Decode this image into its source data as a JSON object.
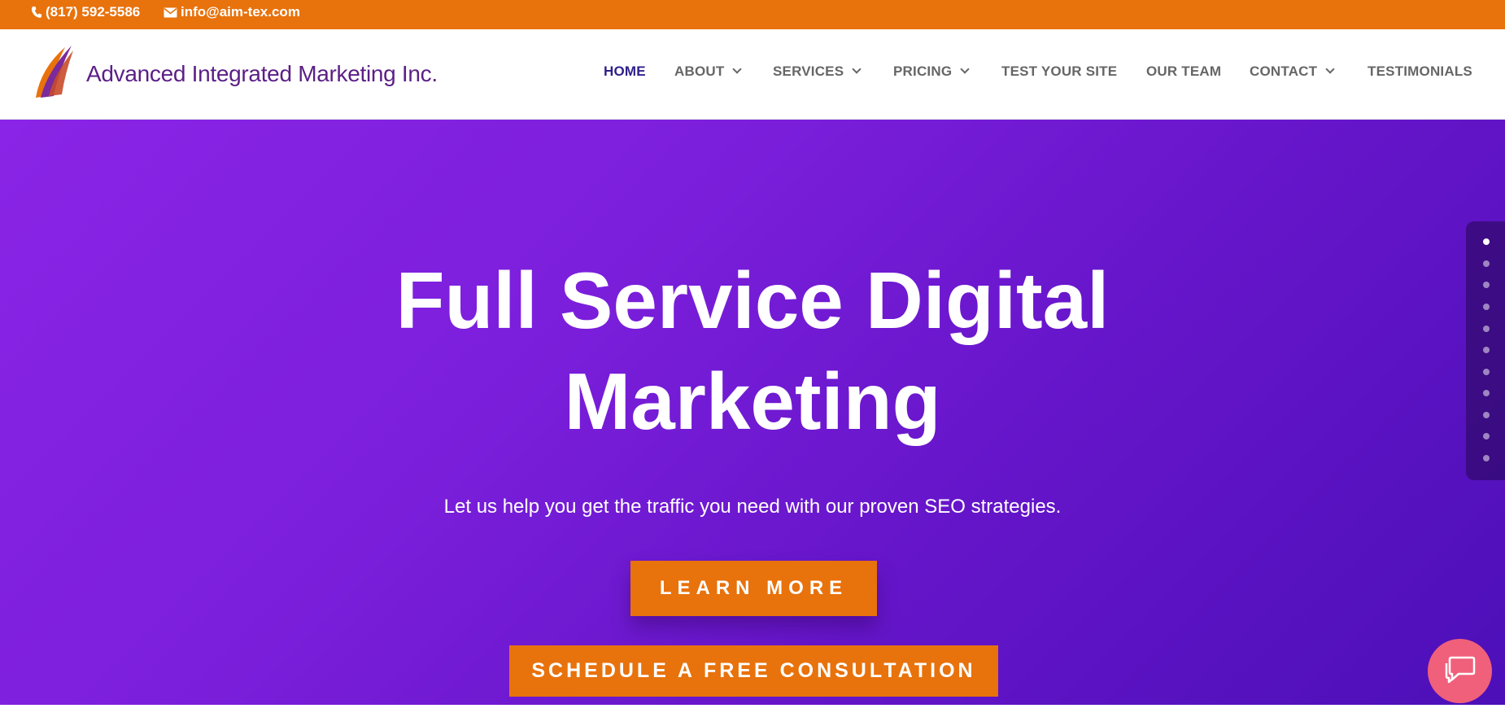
{
  "topbar": {
    "phone": "(817) 592-5586",
    "email": "info@aim-tex.com",
    "background": "#e8720c"
  },
  "header": {
    "logo_text": "Advanced Integrated Marketing Inc.",
    "nav": [
      {
        "label": "HOME",
        "active": true
      },
      {
        "label": "ABOUT",
        "dropdown": true
      },
      {
        "label": "SERVICES",
        "dropdown": true
      },
      {
        "label": "PRICING",
        "dropdown": true
      },
      {
        "label": "TEST YOUR SITE"
      },
      {
        "label": "OUR TEAM"
      },
      {
        "label": "CONTACT",
        "dropdown": true
      },
      {
        "label": "TESTIMONIALS"
      }
    ]
  },
  "hero": {
    "title_line1": "Full Service Digital",
    "title_line2": "Marketing",
    "subtitle": "Let us help you get the traffic you need with our proven SEO strategies.",
    "learn_more": "LEARN MORE",
    "consult": "SCHEDULE A FREE CONSULTATION",
    "gradient_start": "#8a24e6",
    "gradient_end": "#4c0fb8",
    "button_color": "#e8720c"
  },
  "side_dots": {
    "count": 11,
    "active_index": 0
  },
  "chat": {
    "icon": "chat-icon",
    "color": "#f0607a"
  }
}
